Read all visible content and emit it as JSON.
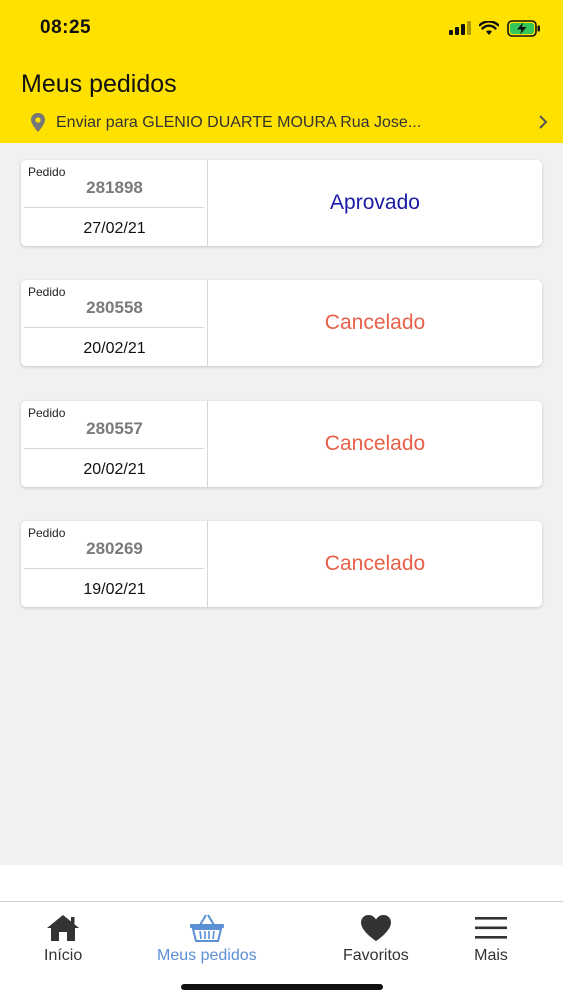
{
  "status": {
    "time": "08:25"
  },
  "header": {
    "title": "Meus pedidos",
    "address": "Enviar para GLENIO DUARTE MOURA Rua Jose..."
  },
  "orders": [
    {
      "label": "Pedido",
      "number": "281898",
      "date": "27/02/21",
      "status": "Aprovado",
      "status_color": "#1a1aa6"
    },
    {
      "label": "Pedido",
      "number": "280558",
      "date": "20/02/21",
      "status": "Cancelado",
      "status_color": "#e8604a"
    },
    {
      "label": "Pedido",
      "number": "280557",
      "date": "20/02/21",
      "status": "Cancelado",
      "status_color": "#e8604a"
    },
    {
      "label": "Pedido",
      "number": "280269",
      "date": "19/02/21",
      "status": "Cancelado",
      "status_color": "#e8604a"
    }
  ],
  "tabs": [
    {
      "label": "Início",
      "icon": "home-icon",
      "active": false
    },
    {
      "label": "Meus pedidos",
      "icon": "basket-icon",
      "active": true
    },
    {
      "label": "Favoritos",
      "icon": "heart-icon",
      "active": false
    },
    {
      "label": "Mais",
      "icon": "menu-icon",
      "active": false
    }
  ],
  "colors": {
    "header_bg": "#ffe100",
    "active_tab": "#5b8fd6",
    "approved": "#1a1aa6",
    "cancelled": "#e8604a"
  }
}
